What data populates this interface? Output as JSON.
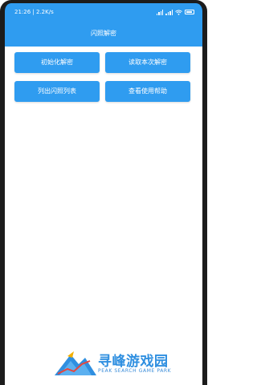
{
  "status_bar": {
    "time_speed": "21:26 | 2.2K/s",
    "battery_level": "55"
  },
  "header": {
    "title": "闪照解密"
  },
  "buttons": [
    {
      "label": "初始化解密"
    },
    {
      "label": "读取本次解密"
    },
    {
      "label": "列出闪照列表"
    },
    {
      "label": "查看使用帮助"
    }
  ],
  "watermark": {
    "name": "寻峰游戏园",
    "sub": "PEAK SEARCH GAME PARK"
  },
  "colors": {
    "accent": "#2f9cf0",
    "background": "#ffffff"
  }
}
